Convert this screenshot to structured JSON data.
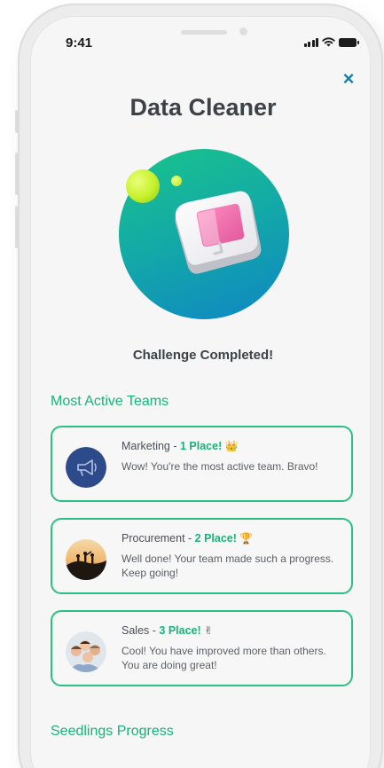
{
  "status_bar": {
    "time": "9:41"
  },
  "header": {
    "close_label": "×",
    "title": "Data Cleaner"
  },
  "hero": {
    "icon": "monitor-badge-icon"
  },
  "subtitle": "Challenge Completed!",
  "sections": {
    "active_teams": "Most Active Teams",
    "seedlings": "Seedlings Progress"
  },
  "teams": [
    {
      "name": "Marketing",
      "separator": " - ",
      "place": "1 Place!",
      "badge": "👑",
      "message": "Wow! You're the most active team. Bravo!",
      "avatar_icon": "megaphone-icon"
    },
    {
      "name": "Procurement",
      "separator": " - ",
      "place": "2 Place!",
      "badge": "🏆",
      "message": "Well done! Your team made such a progress. Keep going!",
      "avatar_icon": "team-silhouette-photo"
    },
    {
      "name": "Sales",
      "separator": " - ",
      "place": "3 Place!",
      "badge": "✌",
      "message": "Cool! You have improved more than others. You are doing great!",
      "avatar_icon": "team-group-photo"
    }
  ],
  "colors": {
    "accent_green": "#17b37a",
    "card_border": "#2bbf86",
    "close_blue": "#1a7fa6",
    "title_gray": "#3d4248",
    "marketing_avatar": "#2d4a8a"
  }
}
